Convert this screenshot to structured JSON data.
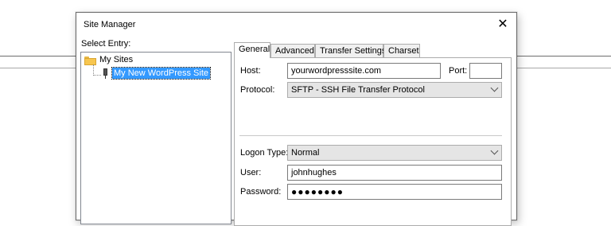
{
  "window": {
    "title": "Site Manager",
    "close_glyph": "✕"
  },
  "sidebar": {
    "label": "Select Entry:",
    "tree": {
      "root": {
        "label": "My Sites",
        "icon": "folder-icon"
      },
      "child": {
        "label": "My New WordPress Site",
        "icon": "server-icon",
        "selected": true
      }
    }
  },
  "tabs": [
    {
      "label": "General",
      "active": true
    },
    {
      "label": "Advanced",
      "active": false
    },
    {
      "label": "Transfer Settings",
      "active": false
    },
    {
      "label": "Charset",
      "active": false
    }
  ],
  "general": {
    "host_label": "Host:",
    "host_value": "yourwordpresssite.com",
    "port_label": "Port:",
    "port_value": "",
    "protocol_label": "Protocol:",
    "protocol_value": "SFTP - SSH File Transfer Protocol",
    "logon_type_label": "Logon Type:",
    "logon_type_value": "Normal",
    "user_label": "User:",
    "user_value": "johnhughes",
    "password_label": "Password:",
    "password_value": "●●●●●●●●"
  },
  "colors": {
    "selection": "#3399ff",
    "folder": "#f7c64f"
  }
}
